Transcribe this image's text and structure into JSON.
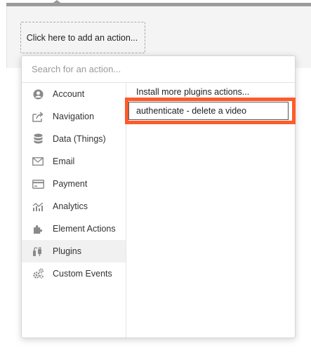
{
  "add_action": {
    "label": "Click here to add an action..."
  },
  "search": {
    "placeholder": "Search for an action..."
  },
  "categories": [
    {
      "label": "Account",
      "icon": "account-icon"
    },
    {
      "label": "Navigation",
      "icon": "navigation-icon"
    },
    {
      "label": "Data (Things)",
      "icon": "database-icon"
    },
    {
      "label": "Email",
      "icon": "email-icon"
    },
    {
      "label": "Payment",
      "icon": "payment-icon"
    },
    {
      "label": "Analytics",
      "icon": "analytics-icon"
    },
    {
      "label": "Element Actions",
      "icon": "puzzle-icon"
    },
    {
      "label": "Plugins",
      "icon": "plug-icon"
    },
    {
      "label": "Custom Events",
      "icon": "gears-icon"
    }
  ],
  "selected_category": "Plugins",
  "options": [
    {
      "label": "Install more plugins actions..."
    },
    {
      "label": "authenticate - delete a video"
    }
  ],
  "colors": {
    "highlight": "#ff5a2a",
    "accent_gray": "#9b9b9b"
  }
}
